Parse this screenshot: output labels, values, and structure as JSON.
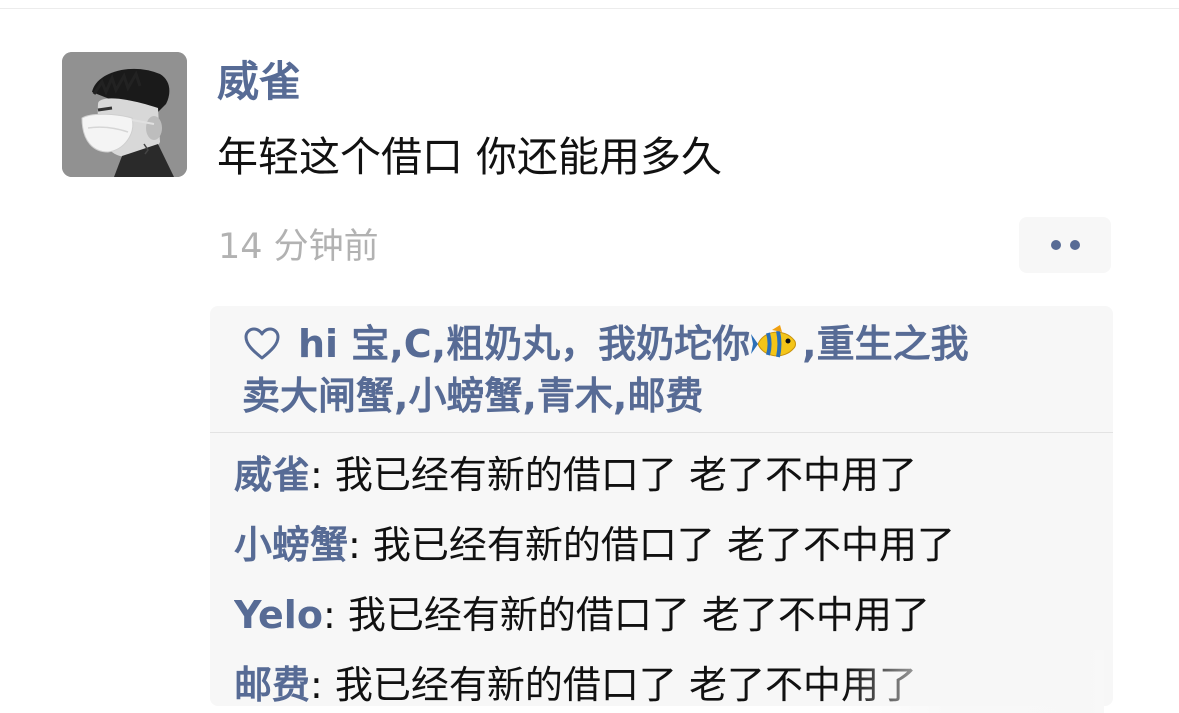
{
  "post": {
    "author": "威雀",
    "text": "年轻这个借口 你还能用多久",
    "timestamp": "14 分钟前"
  },
  "icons": {
    "more": "more-dots-icon",
    "heart": "heart-outline-icon",
    "fish": "tropical-fish-emoji"
  },
  "likes": [
    {
      "name": "hi 宝",
      "sep": ", "
    },
    {
      "name": "C",
      "sep": ", "
    },
    {
      "name": "粗奶丸",
      "sep": "，"
    },
    {
      "name": "我奶坨你",
      "sep": ", "
    },
    {
      "name": "重生之我卖大闸蟹",
      "sep": ", "
    },
    {
      "name": "小螃蟹",
      "sep": ", "
    },
    {
      "name": "青木",
      "sep": ", "
    },
    {
      "name": "邮费",
      "sep": ""
    }
  ],
  "comments": [
    {
      "author": "威雀",
      "colon": ": ",
      "text": "我已经有新的借口了 老了不中用了"
    },
    {
      "author": "小螃蟹",
      "colon": ": ",
      "text": "我已经有新的借口了 老了不中用了"
    },
    {
      "author": "Yelo",
      "colon": ": ",
      "text": "我已经有新的借口了 老了不中用了"
    },
    {
      "author": "邮费",
      "colon": ": ",
      "text": "我已经有新的借口了 老了不中用了"
    }
  ],
  "colors": {
    "link": "#576b95",
    "text": "#111111",
    "muted": "#b2b2b2",
    "panel": "#f7f7f7"
  }
}
